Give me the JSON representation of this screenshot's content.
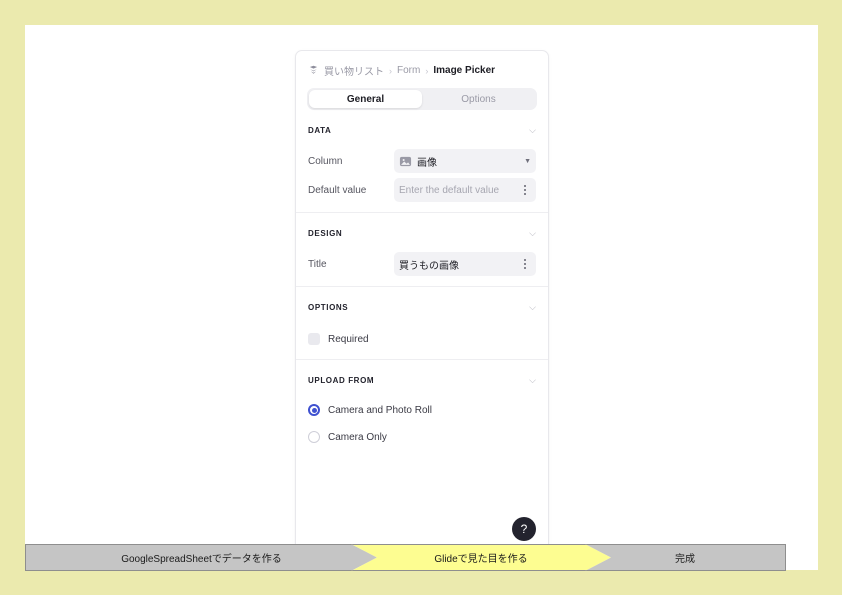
{
  "page": {
    "background_color": "#ebeaae",
    "slide_color": "#ffffff"
  },
  "panel": {
    "breadcrumb": {
      "app_icon": "glide-app-icon",
      "items": [
        {
          "label": "買い物リスト",
          "current": false
        },
        {
          "label": "Form",
          "current": false
        },
        {
          "label": "Image Picker",
          "current": true
        }
      ],
      "separator": "›"
    },
    "tabs": [
      {
        "label": "General",
        "active": true
      },
      {
        "label": "Options",
        "active": false
      }
    ],
    "sections": [
      {
        "title": "DATA",
        "rows": [
          {
            "label": "Column",
            "value": "画像",
            "icon": "image-icon",
            "control": "dropdown"
          },
          {
            "label": "Default value",
            "value": "",
            "placeholder": "Enter the default value",
            "control": "text-input-with-menu"
          }
        ]
      },
      {
        "title": "DESIGN",
        "rows": [
          {
            "label": "Title",
            "value": "買うもの画像",
            "control": "text-input-with-menu"
          }
        ]
      },
      {
        "title": "OPTIONS",
        "checkboxes": [
          {
            "label": "Required",
            "checked": false
          }
        ]
      },
      {
        "title": "UPLOAD FROM",
        "radios": [
          {
            "label": "Camera and Photo Roll",
            "selected": true
          },
          {
            "label": "Camera Only",
            "selected": false
          }
        ],
        "accent_color": "#3f51d0"
      }
    ],
    "help_button": {
      "label": "?"
    }
  },
  "step_banner": {
    "steps": [
      {
        "label": "GoogleSpreadSheetでデータを作る",
        "color": "#c5c5c5",
        "active": false
      },
      {
        "label": "Glideで見た目を作る",
        "color": "#fdfd91",
        "active": true
      },
      {
        "label": "完成",
        "color": "#c5c5c5",
        "active": false
      }
    ]
  }
}
